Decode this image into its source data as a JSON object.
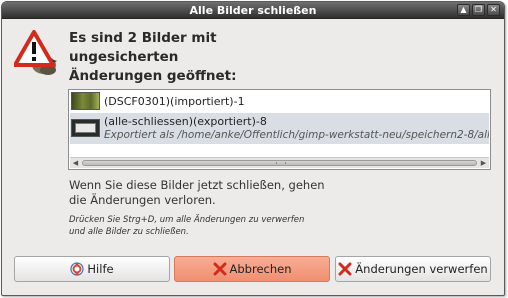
{
  "window": {
    "title": "Alle Bilder schließen",
    "controls": [
      "up-icon",
      "restore-icon",
      "close-icon"
    ]
  },
  "dialog": {
    "headline": "Es sind 2 Bilder mit ungesicherten Änderungen geöffnet:",
    "images": [
      {
        "name": "(DSCF0301)(importiert)-1",
        "detail": ""
      },
      {
        "name": "(alle-schliessen)(exportiert)-8",
        "detail": "Exportiert als /home/anke/Öffentlich/gimp-werkstatt-neu/speichern2-8/alle"
      }
    ],
    "info": "Wenn Sie diese Bilder jetzt schließen, gehen die Änderungen verloren.",
    "hint": "Drücken Sie Strg+D, um alle Änderungen zu verwerfen und alle Bilder zu schließen."
  },
  "buttons": {
    "help": "Hilfe",
    "cancel": "Abbrechen",
    "discard": "Änderungen verwerfen"
  },
  "colors": {
    "titlebar": "#3c3c3c",
    "selected_row": "#d9dee4",
    "cancel_button": "#f29a7c",
    "danger_icon": "#d42a1e"
  }
}
